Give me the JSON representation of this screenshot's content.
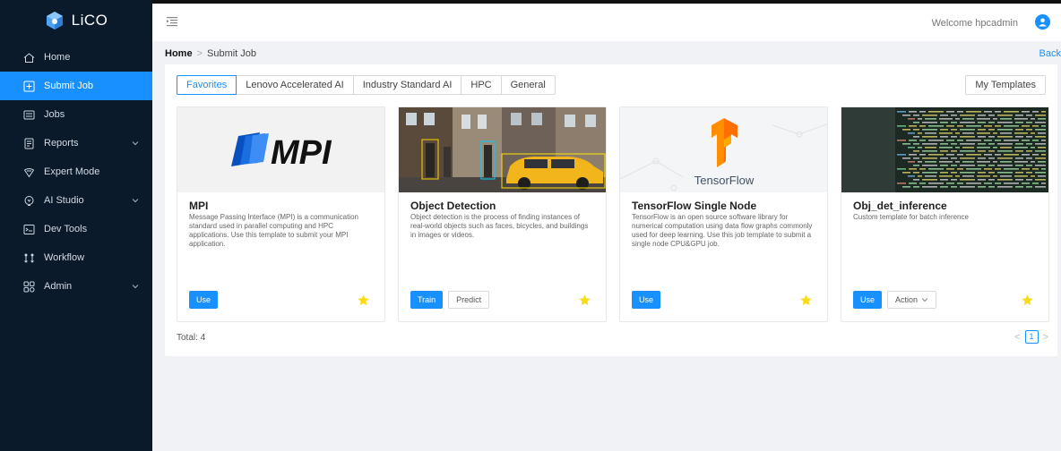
{
  "app": {
    "logo_text": "LiCO",
    "brand_color": "#1890ff"
  },
  "sidebar": {
    "items": [
      {
        "label": "Home",
        "icon": "home-icon",
        "active": false,
        "has_submenu": false
      },
      {
        "label": "Submit Job",
        "icon": "plus-square-icon",
        "active": true,
        "has_submenu": false
      },
      {
        "label": "Jobs",
        "icon": "jobs-list-icon",
        "active": false,
        "has_submenu": false
      },
      {
        "label": "Reports",
        "icon": "report-icon",
        "active": false,
        "has_submenu": true
      },
      {
        "label": "Expert Mode",
        "icon": "expert-icon",
        "active": false,
        "has_submenu": false
      },
      {
        "label": "AI Studio",
        "icon": "ai-studio-icon",
        "active": false,
        "has_submenu": true
      },
      {
        "label": "Dev Tools",
        "icon": "dev-tools-icon",
        "active": false,
        "has_submenu": false
      },
      {
        "label": "Workflow",
        "icon": "workflow-icon",
        "active": false,
        "has_submenu": false
      },
      {
        "label": "Admin",
        "icon": "admin-icon",
        "active": false,
        "has_submenu": true
      }
    ]
  },
  "header": {
    "welcome": "Welcome hpcadmin"
  },
  "breadcrumb": {
    "home": "Home",
    "separator": ">",
    "current": "Submit Job",
    "back": "Back"
  },
  "tabs": [
    "Favorites",
    "Lenovo Accelerated AI",
    "Industry Standard AI",
    "HPC",
    "General"
  ],
  "active_tab": "Favorites",
  "my_templates": "My Templates",
  "cards": [
    {
      "title": "MPI",
      "description": "Message Passing Interface (MPI) is a communication standard used in parallel computing and HPC applications. Use this template to submit your MPI application.",
      "image_text": "MPI",
      "buttons": [
        {
          "label": "Use",
          "style": "primary"
        }
      ],
      "favorited": true
    },
    {
      "title": "Object Detection",
      "description": "Object detection is the process of finding instances of real-world objects such as faces, bicycles, and buildings in images or videos.",
      "image_text": "",
      "buttons": [
        {
          "label": "Train",
          "style": "primary"
        },
        {
          "label": "Predict",
          "style": "default"
        }
      ],
      "favorited": true
    },
    {
      "title": "TensorFlow Single Node",
      "description": "TensorFlow is an open source software library for numerical computation using data flow graphs commonly used for deep learning. Use this job template to submit a single node CPU&GPU job.",
      "image_text": "TensorFlow",
      "buttons": [
        {
          "label": "Use",
          "style": "primary"
        }
      ],
      "favorited": true
    },
    {
      "title": "Obj_det_inference",
      "description": "Custom template for batch inference",
      "image_text": "",
      "buttons": [
        {
          "label": "Use",
          "style": "primary"
        },
        {
          "label": "Action",
          "style": "dropdown"
        }
      ],
      "favorited": true
    }
  ],
  "footer": {
    "total": "Total: 4",
    "current_page": "1"
  }
}
